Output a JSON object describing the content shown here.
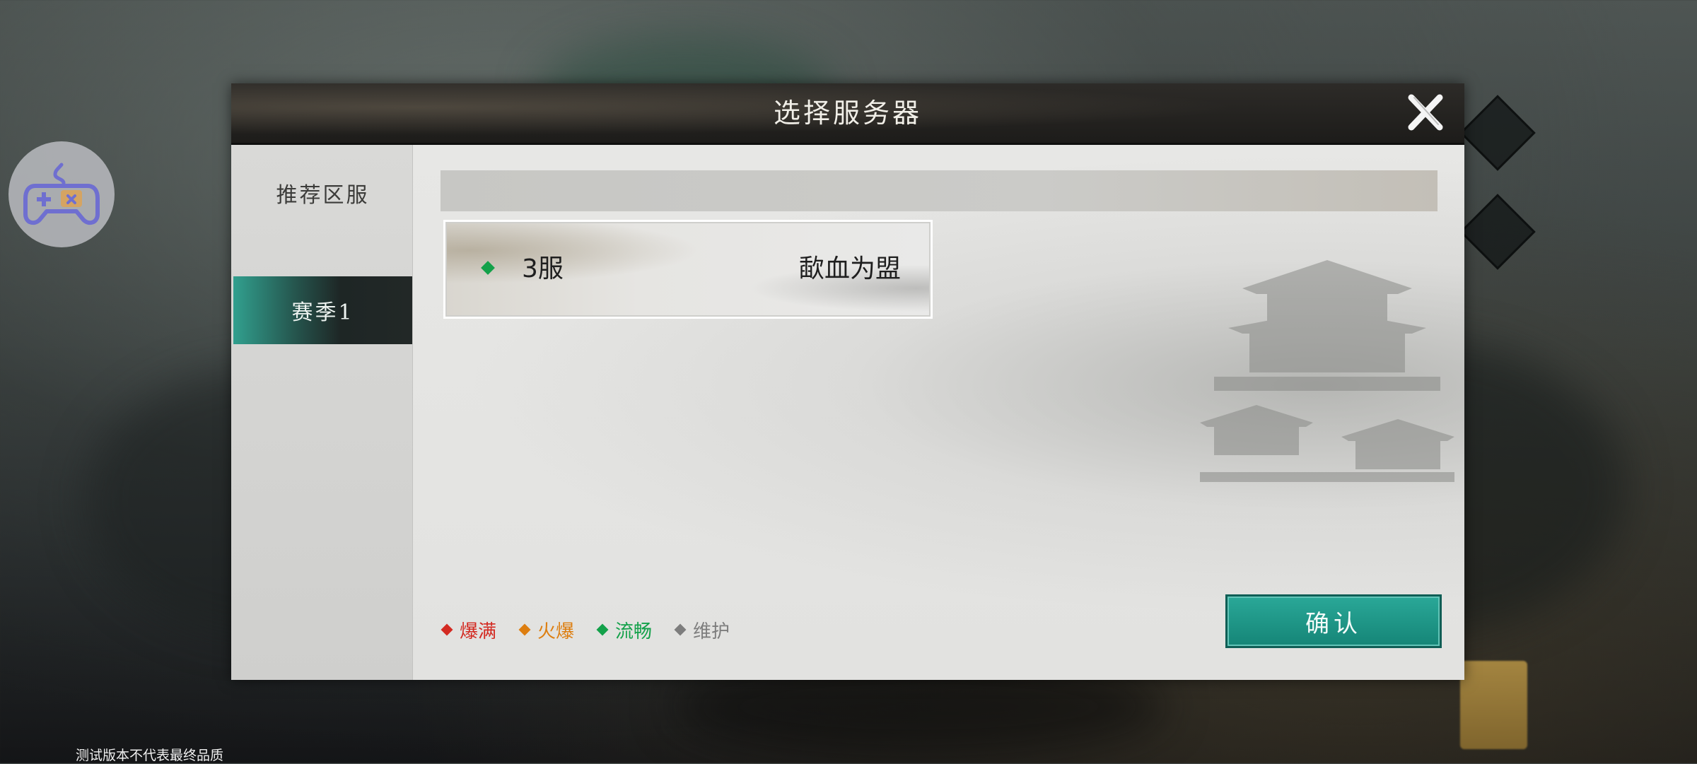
{
  "dialog": {
    "title": "选择服务器",
    "close_icon": "close-icon"
  },
  "sidebar": {
    "items": [
      {
        "label": "推荐区服",
        "selected": false
      },
      {
        "label": "赛季1",
        "selected": true
      }
    ]
  },
  "servers": [
    {
      "status": "流畅",
      "status_color": "#13a14a",
      "name": "3服",
      "guild": "歃血为盟"
    }
  ],
  "legend": [
    {
      "label": "爆满",
      "color": "#d32a22"
    },
    {
      "label": "火爆",
      "color": "#dd7e10"
    },
    {
      "label": "流畅",
      "color": "#13a14a"
    },
    {
      "label": "维护",
      "color": "#7d7d7d"
    }
  ],
  "confirm_label": "确认",
  "watermark": "测试版本不代表最终品质",
  "colors": {
    "accent_teal": "#1f9a8b",
    "header_dark": "#1d1c1a"
  }
}
